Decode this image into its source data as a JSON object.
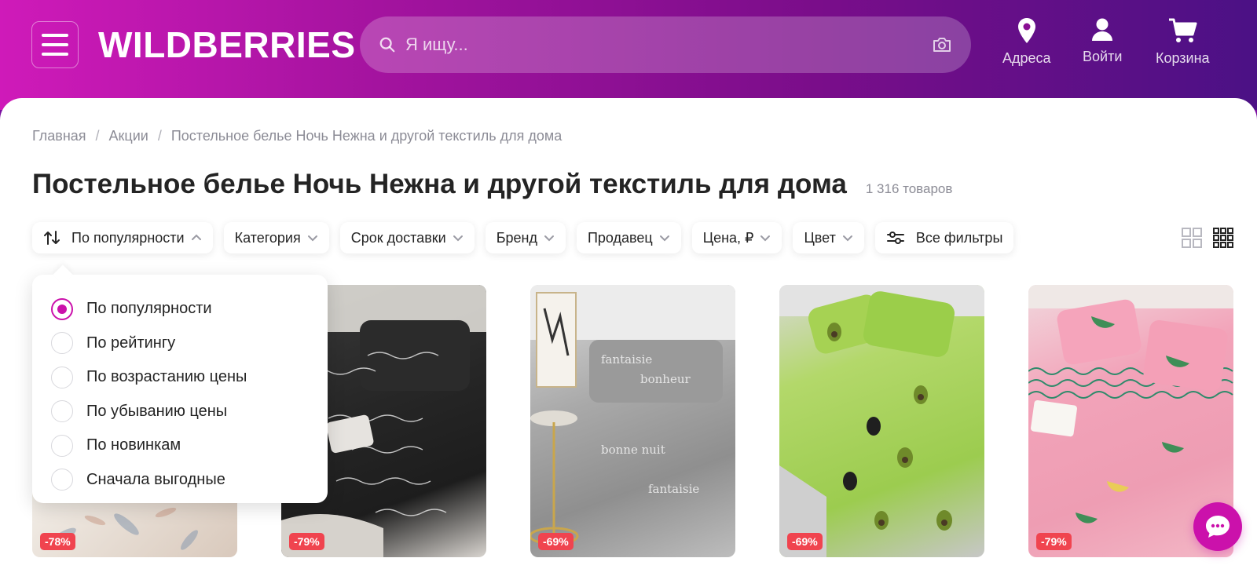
{
  "header": {
    "logo": "WILDBERRIES",
    "search_placeholder": "Я ищу...",
    "addresses_label": "Адреса",
    "login_label": "Войти",
    "cart_label": "Корзина"
  },
  "breadcrumbs": [
    "Главная",
    "Акции",
    "Постельное белье Ночь Нежна и другой текстиль для дома"
  ],
  "page": {
    "title": "Постельное белье Ночь Нежна и другой текстиль для дома",
    "count": "1 316 товаров"
  },
  "filters": {
    "sort": "По популярности",
    "category": "Категория",
    "delivery": "Срок доставки",
    "brand": "Бренд",
    "seller": "Продавец",
    "price": "Цена, ₽",
    "color": "Цвет",
    "all": "Все фильтры"
  },
  "sort_options": [
    {
      "label": "По популярности",
      "selected": true
    },
    {
      "label": "По рейтингу",
      "selected": false
    },
    {
      "label": "По возрастанию цены",
      "selected": false
    },
    {
      "label": "По убыванию цены",
      "selected": false
    },
    {
      "label": "По новинкам",
      "selected": false
    },
    {
      "label": "Сначала выгодные",
      "selected": false
    }
  ],
  "products": [
    {
      "discount": "-78%"
    },
    {
      "discount": "-79%"
    },
    {
      "discount": "-69%"
    },
    {
      "discount": "-69%"
    },
    {
      "discount": "-79%"
    }
  ],
  "colors": {
    "accent": "#cb11ab",
    "discount": "#f0444f"
  }
}
